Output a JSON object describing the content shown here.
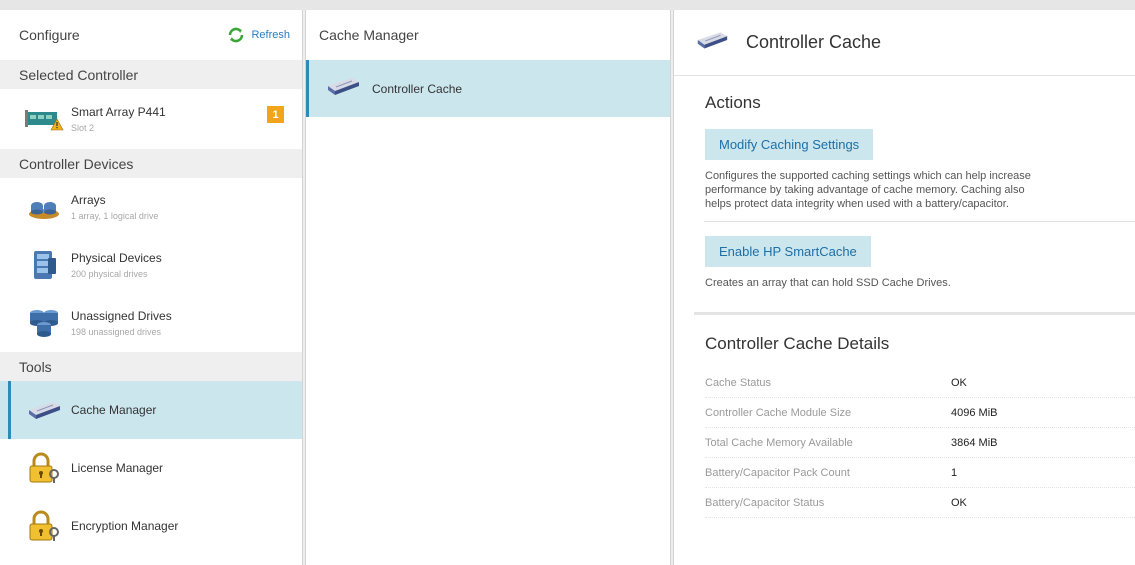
{
  "left": {
    "title": "Configure",
    "refresh_label": "Refresh",
    "sections": {
      "selected_controller": "Selected Controller",
      "controller_devices": "Controller Devices",
      "tools": "Tools"
    },
    "controller": {
      "label": "Smart Array P441",
      "sub": "Slot 2",
      "badge": "1",
      "icon": "controller-card-warning-icon"
    },
    "devices": [
      {
        "label": "Arrays",
        "sub": "1 array, 1 logical drive",
        "icon": "arrays-icon"
      },
      {
        "label": "Physical Devices",
        "sub": "200 physical drives",
        "icon": "physical-devices-icon"
      },
      {
        "label": "Unassigned Drives",
        "sub": "198 unassigned drives",
        "icon": "unassigned-drives-icon"
      }
    ],
    "tools": [
      {
        "label": "Cache Manager",
        "icon": "cache-module-icon",
        "selected": true
      },
      {
        "label": "License Manager",
        "icon": "license-lock-icon"
      },
      {
        "label": "Encryption Manager",
        "icon": "encryption-lock-icon"
      }
    ]
  },
  "middle": {
    "title": "Cache Manager",
    "item": {
      "label": "Controller Cache",
      "icon": "cache-module-icon"
    }
  },
  "right": {
    "title": "Controller Cache",
    "actions_title": "Actions",
    "actions": [
      {
        "label": "Modify Caching Settings",
        "desc_lines": [
          "Configures the supported caching settings which can help increase",
          "performance by taking advantage of cache memory. Caching also",
          "helps protect data integrity when used with a battery/capacitor."
        ]
      },
      {
        "label": "Enable HP SmartCache",
        "desc_lines": [
          "Creates an array that can hold SSD Cache Drives."
        ]
      }
    ],
    "details_title": "Controller Cache Details",
    "details": [
      {
        "key": "Cache Status",
        "value": "OK"
      },
      {
        "key": "Controller Cache Module Size",
        "value": "4096 MiB"
      },
      {
        "key": "Total Cache Memory Available",
        "value": "3864 MiB"
      },
      {
        "key": "Battery/Capacitor Pack Count",
        "value": "1"
      },
      {
        "key": "Battery/Capacitor Status",
        "value": "OK"
      }
    ]
  },
  "colors": {
    "selection_bg": "#cce6ee",
    "selection_bar": "#2f8ab6",
    "link_blue": "#2a7bbf",
    "badge_orange": "#f0a51a",
    "section_header_bg": "#efefef"
  }
}
